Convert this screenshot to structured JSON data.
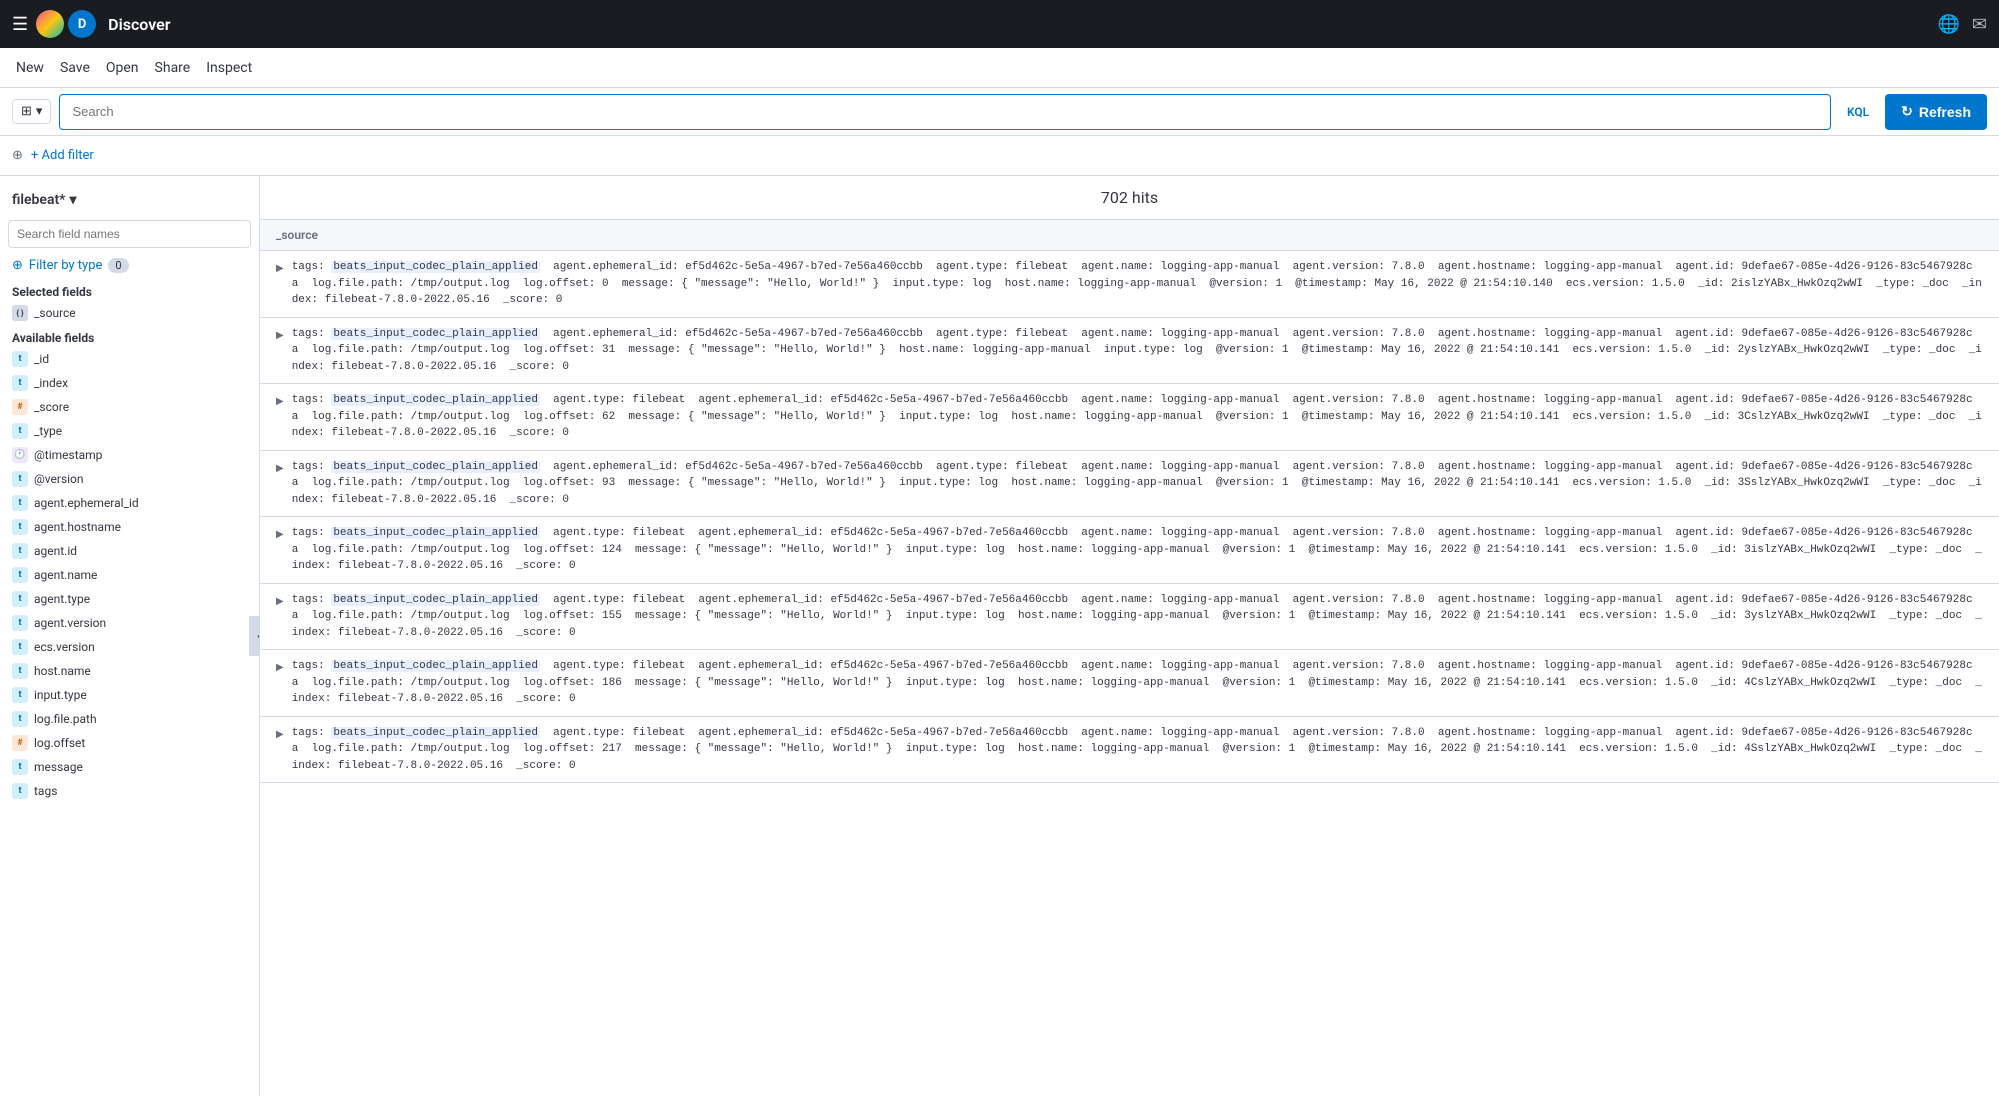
{
  "topbar": {
    "title": "Discover",
    "logo_letter": "D"
  },
  "menubar": {
    "items": [
      "New",
      "Save",
      "Open",
      "Share",
      "Inspect"
    ]
  },
  "searchbar": {
    "placeholder": "Search",
    "kql_label": "KQL",
    "refresh_label": "Refresh"
  },
  "filterbar": {
    "add_filter_label": "+ Add filter"
  },
  "sidebar": {
    "pattern": "filebeat*",
    "search_placeholder": "Search field names",
    "filter_by_type_label": "Filter by type",
    "filter_count": "0",
    "selected_section_label": "Selected fields",
    "available_section_label": "Available fields",
    "selected_fields": [
      {
        "name": "_source",
        "icon_type": "source"
      }
    ],
    "available_fields": [
      {
        "name": "_id",
        "icon_type": "t"
      },
      {
        "name": "_index",
        "icon_type": "t"
      },
      {
        "name": "_score",
        "icon_type": "hash"
      },
      {
        "name": "_type",
        "icon_type": "t"
      },
      {
        "name": "@timestamp",
        "icon_type": "clock"
      },
      {
        "name": "@version",
        "icon_type": "t"
      },
      {
        "name": "agent.ephemeral_id",
        "icon_type": "t"
      },
      {
        "name": "agent.hostname",
        "icon_type": "t"
      },
      {
        "name": "agent.id",
        "icon_type": "t"
      },
      {
        "name": "agent.name",
        "icon_type": "t"
      },
      {
        "name": "agent.type",
        "icon_type": "t"
      },
      {
        "name": "agent.version",
        "icon_type": "t"
      },
      {
        "name": "ecs.version",
        "icon_type": "t"
      },
      {
        "name": "host.name",
        "icon_type": "t"
      },
      {
        "name": "input.type",
        "icon_type": "t"
      },
      {
        "name": "log.file.path",
        "icon_type": "t"
      },
      {
        "name": "log.offset",
        "icon_type": "hash"
      },
      {
        "name": "message",
        "icon_type": "t"
      },
      {
        "name": "tags",
        "icon_type": "t"
      }
    ]
  },
  "results": {
    "hits_count": "702",
    "hits_label": "hits",
    "source_column_label": "_source",
    "rows": [
      "tags: beats_input_codec_plain_applied  agent.ephemeral_id: ef5d462c-5e5a-4967-b7ed-7e56a460ccbb  agent.type: filebeat  agent.name: logging-app-manual  agent.version: 7.8.0  agent.hostname: logging-app-manual  agent.id: 9defae67-085e-4d26-9126-83c5467928ca  log.file.path: /tmp/output.log  log.offset: 0  message: { \"message\": \"Hello, World!\" }  input.type: log  host.name: logging-app-manual  @version: 1  @timestamp: May 16, 2022 @ 21:54:10.140  ecs.version: 1.5.0  _id: 2islzYABx_HwkOzq2wWI  _type: _doc  _index: filebeat-7.8.0-2022.05.16  _score: 0",
      "tags: beats_input_codec_plain_applied  agent.ephemeral_id: ef5d462c-5e5a-4967-b7ed-7e56a460ccbb  agent.type: filebeat  agent.name: logging-app-manual  agent.version: 7.8.0  agent.hostname: logging-app-manual  agent.id: 9defae67-085e-4d26-9126-83c5467928ca  log.file.path: /tmp/output.log  log.offset: 31  message: { \"message\": \"Hello, World!\" }  host.name: logging-app-manual  input.type: log  @version: 1  @timestamp: May 16, 2022 @ 21:54:10.141  ecs.version: 1.5.0  _id: 2yslzYABx_HwkOzq2wWI  _type: _doc  _index: filebeat-7.8.0-2022.05.16  _score: 0",
      "tags: beats_input_codec_plain_applied  agent.type: filebeat  agent.ephemeral_id: ef5d462c-5e5a-4967-b7ed-7e56a460ccbb  agent.name: logging-app-manual  agent.version: 7.8.0  agent.hostname: logging-app-manual  agent.id: 9defae67-085e-4d26-9126-83c5467928ca  log.file.path: /tmp/output.log  log.offset: 62  message: { \"message\": \"Hello, World!\" }  input.type: log  host.name: logging-app-manual  @version: 1  @timestamp: May 16, 2022 @ 21:54:10.141  ecs.version: 1.5.0  _id: 3CslzYABx_HwkOzq2wWI  _type: _doc  _index: filebeat-7.8.0-2022.05.16  _score: 0",
      "tags: beats_input_codec_plain_applied  agent.ephemeral_id: ef5d462c-5e5a-4967-b7ed-7e56a460ccbb  agent.type: filebeat  agent.name: logging-app-manual  agent.version: 7.8.0  agent.hostname: logging-app-manual  agent.id: 9defae67-085e-4d26-9126-83c5467928ca  log.file.path: /tmp/output.log  log.offset: 93  message: { \"message\": \"Hello, World!\" }  input.type: log  host.name: logging-app-manual  @version: 1  @timestamp: May 16, 2022 @ 21:54:10.141  ecs.version: 1.5.0  _id: 3SslzYABx_HwkOzq2wWI  _type: _doc  _index: filebeat-7.8.0-2022.05.16  _score: 0",
      "tags: beats_input_codec_plain_applied  agent.type: filebeat  agent.ephemeral_id: ef5d462c-5e5a-4967-b7ed-7e56a460ccbb  agent.name: logging-app-manual  agent.version: 7.8.0  agent.hostname: logging-app-manual  agent.id: 9defae67-085e-4d26-9126-83c5467928ca  log.file.path: /tmp/output.log  log.offset: 124  message: { \"message\": \"Hello, World!\" }  input.type: log  host.name: logging-app-manual  @version: 1  @timestamp: May 16, 2022 @ 21:54:10.141  ecs.version: 1.5.0  _id: 3islzYABx_HwkOzq2wWI  _type: _doc  _index: filebeat-7.8.0-2022.05.16  _score: 0",
      "tags: beats_input_codec_plain_applied  agent.type: filebeat  agent.ephemeral_id: ef5d462c-5e5a-4967-b7ed-7e56a460ccbb  agent.name: logging-app-manual  agent.version: 7.8.0  agent.hostname: logging-app-manual  agent.id: 9defae67-085e-4d26-9126-83c5467928ca  log.file.path: /tmp/output.log  log.offset: 155  message: { \"message\": \"Hello, World!\" }  input.type: log  host.name: logging-app-manual  @version: 1  @timestamp: May 16, 2022 @ 21:54:10.141  ecs.version: 1.5.0  _id: 3yslzYABx_HwkOzq2wWI  _type: _doc  _index: filebeat-7.8.0-2022.05.16  _score: 0",
      "tags: beats_input_codec_plain_applied  agent.type: filebeat  agent.ephemeral_id: ef5d462c-5e5a-4967-b7ed-7e56a460ccbb  agent.name: logging-app-manual  agent.version: 7.8.0  agent.hostname: logging-app-manual  agent.id: 9defae67-085e-4d26-9126-83c5467928ca  log.file.path: /tmp/output.log  log.offset: 186  message: { \"message\": \"Hello, World!\" }  input.type: log  host.name: logging-app-manual  @version: 1  @timestamp: May 16, 2022 @ 21:54:10.141  ecs.version: 1.5.0  _id: 4CslzYABx_HwkOzq2wWI  _type: _doc  _index: filebeat-7.8.0-2022.05.16  _score: 0",
      "tags: beats_input_codec_plain_applied  agent.type: filebeat  agent.ephemeral_id: ef5d462c-5e5a-4967-b7ed-7e56a460ccbb  agent.name: logging-app-manual  agent.version: 7.8.0  agent.hostname: logging-app-manual  agent.id: 9defae67-085e-4d26-9126-83c5467928ca  log.file.path: /tmp/output.log  log.offset: 217  message: { \"message\": \"Hello, World!\" }  input.type: log  host.name: logging-app-manual  @version: 1  @timestamp: May 16, 2022 @ 21:54:10.141  ecs.version: 1.5.0  _id: 4SslzYABx_HwkOzq2wWI  _type: _doc  _index: filebeat-7.8.0-2022.05.16  _score: 0"
    ]
  },
  "icons": {
    "hamburger": "☰",
    "chevron_down": "▾",
    "expand": "▶",
    "refresh_icon": "↻",
    "globe": "🌐",
    "mail": "✉",
    "filter": "⊕",
    "search": "🔍",
    "info_circle": "ℹ",
    "collapse": "‹"
  }
}
